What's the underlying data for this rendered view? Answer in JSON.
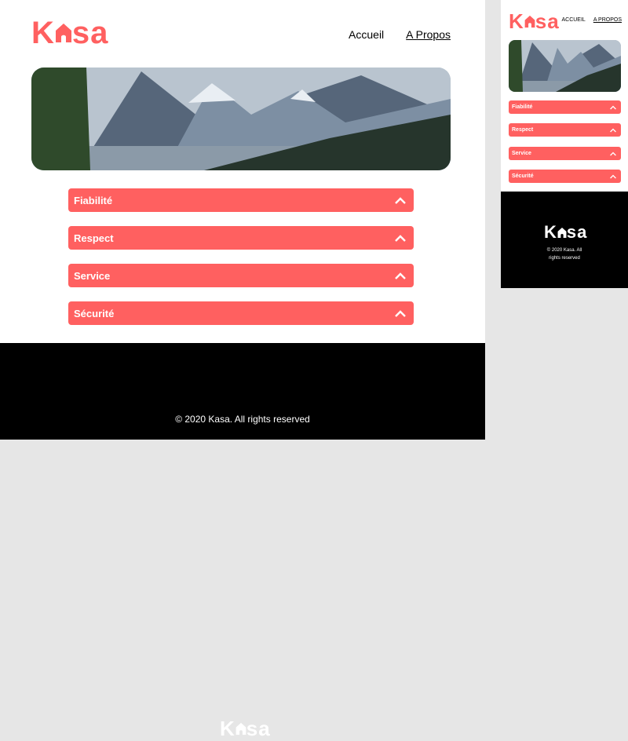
{
  "brand": {
    "logo_k": "K",
    "logo_rest": "sa"
  },
  "nav": {
    "home": "Accueil",
    "about": "A Propos"
  },
  "mobile_nav": {
    "home": "ACCUEIL",
    "about": "A PROPOS"
  },
  "collapsibles": [
    {
      "label": "Fiabilité"
    },
    {
      "label": "Respect"
    },
    {
      "label": "Service"
    },
    {
      "label": "Sécurité"
    }
  ],
  "footer": {
    "copyright": "© 2020 Kasa. All rights reserved"
  },
  "mobile_footer": {
    "copyright_line1": "© 2020 Kasa. All",
    "copyright_line2": "rights reserved"
  },
  "colors": {
    "brand": "#ff6060",
    "footer_bg": "#000000",
    "background": "#ffffff"
  },
  "icons": {
    "logo_house": "house-icon",
    "collapsible": "chevron-up-icon"
  }
}
